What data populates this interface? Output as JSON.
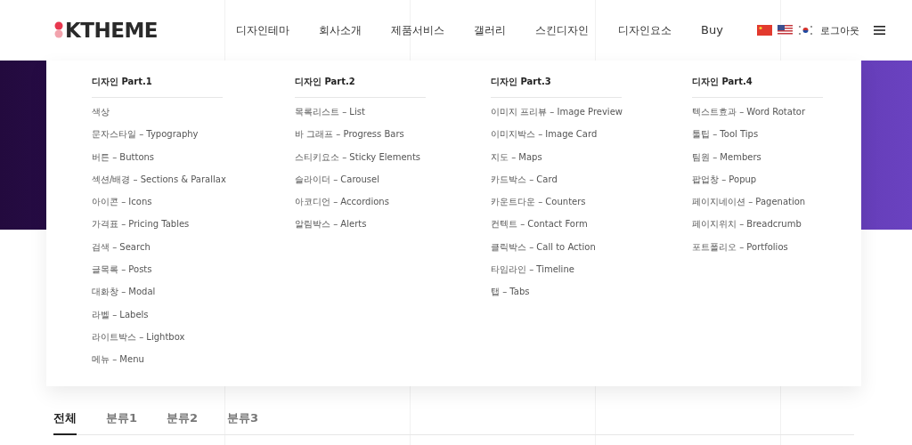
{
  "logo": "KTHEME",
  "nav": [
    {
      "label": "디자인테마"
    },
    {
      "label": "회사소개"
    },
    {
      "label": "제품서비스"
    },
    {
      "label": "갤러리"
    },
    {
      "label": "스킨디자인"
    },
    {
      "label": "디자인요소"
    },
    {
      "label": "Buy"
    }
  ],
  "languages": [
    {
      "kind": "china"
    },
    {
      "kind": "usa"
    },
    {
      "kind": "korea"
    }
  ],
  "logout": "로그아웃",
  "mega_menu": [
    {
      "title": "디자인 Part.1",
      "items": [
        "색상",
        "문자스타일 – Typography",
        "버튼 – Buttons",
        "섹션/배경 – Sections & Parallax",
        "아이콘 – Icons",
        "가격표 – Pricing Tables",
        "검색 – Search",
        "글목록 – Posts",
        "대화창 – Modal",
        "라벨 – Labels",
        "라이트박스 – Lightbox",
        "메뉴 – Menu"
      ]
    },
    {
      "title": "디자인 Part.2",
      "items": [
        "목록리스트 – List",
        "바 그래프 – Progress Bars",
        "스티키요소 – Sticky Elements",
        "슬라이더 – Carousel",
        "아코디언 – Accordions",
        "알림박스 – Alerts"
      ]
    },
    {
      "title": "디자인 Part.3",
      "items": [
        "이미지 프리뷰 – Image Preview",
        "이미지박스 – Image Card",
        "지도 – Maps",
        "카드박스 – Card",
        "카운트다운 – Counters",
        "컨텍트 – Contact Form",
        "클릭박스 – Call to Action",
        "타임라인 – Timeline",
        "탭 – Tabs"
      ]
    },
    {
      "title": "디자인 Part.4",
      "items": [
        "텍스트효과 – Word Rotator",
        "툴팁 – Tool Tips",
        "팀원 – Members",
        "팝업창 – Popup",
        "페이지네이션 – Pagenation",
        "페이지위치 – Breadcrumb",
        "포트폴리오 – Portfolios"
      ]
    }
  ],
  "filter_tabs": [
    {
      "label": "전체",
      "selected": true
    },
    {
      "label": "분류1",
      "selected": false
    },
    {
      "label": "분류2",
      "selected": false
    },
    {
      "label": "분류3",
      "selected": false
    }
  ]
}
